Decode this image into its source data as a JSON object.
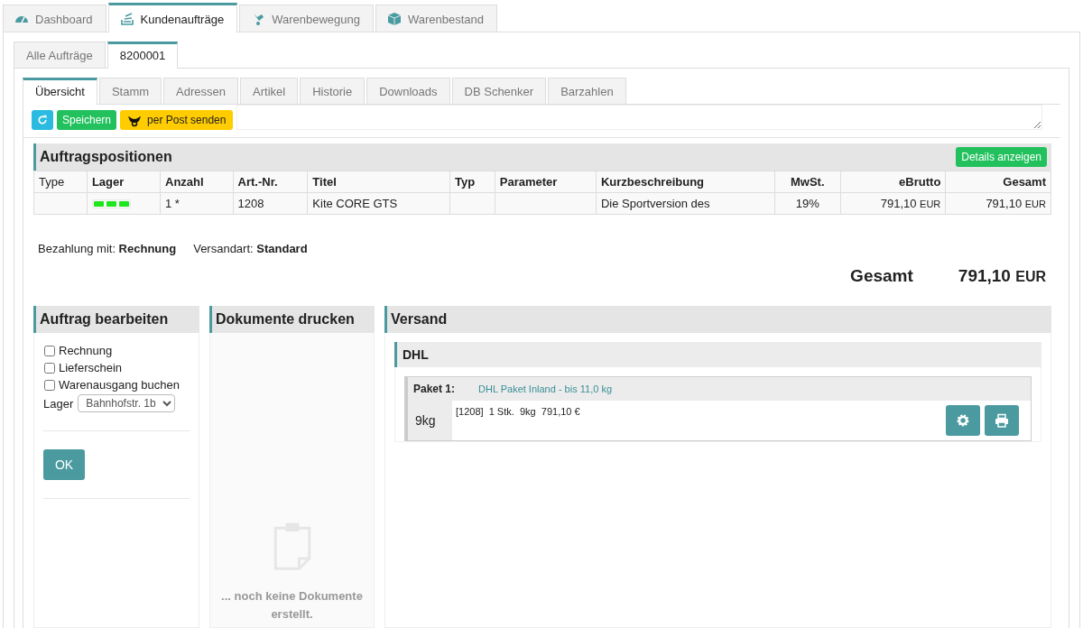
{
  "main_tabs": [
    {
      "label": "Dashboard",
      "selected": false
    },
    {
      "label": "Kundenaufträge",
      "selected": true
    },
    {
      "label": "Warenbewegung",
      "selected": false
    },
    {
      "label": "Warenbestand",
      "selected": false
    }
  ],
  "order_tabs": [
    {
      "label": "Alle Aufträge",
      "selected": false
    },
    {
      "label": "8200001",
      "selected": true
    }
  ],
  "detail_tabs": [
    {
      "label": "Übersicht",
      "selected": true
    },
    {
      "label": "Stamm",
      "selected": false
    },
    {
      "label": "Adressen",
      "selected": false
    },
    {
      "label": "Artikel",
      "selected": false
    },
    {
      "label": "Historie",
      "selected": false
    },
    {
      "label": "Downloads",
      "selected": false
    },
    {
      "label": "DB Schenker",
      "selected": false
    },
    {
      "label": "Barzahlen",
      "selected": false
    }
  ],
  "toolbar": [
    {
      "kind": "refresh"
    },
    {
      "kind": "save",
      "label": "Speichern"
    },
    {
      "kind": "post",
      "label": "per Post senden"
    }
  ],
  "positions": {
    "title": "Auftragspositionen",
    "details_button": "Details anzeigen",
    "columns": [
      {
        "label": "Type",
        "bold": false
      },
      {
        "label": "Lager",
        "bold": true
      },
      {
        "label": "Anzahl",
        "bold": true
      },
      {
        "label": "Art.-Nr.",
        "bold": true
      },
      {
        "label": "Titel",
        "bold": true
      },
      {
        "label": "Typ",
        "bold": true
      },
      {
        "label": "Parameter",
        "bold": true
      },
      {
        "label": "Kurzbeschreibung",
        "bold": true
      },
      {
        "label": "MwSt.",
        "bold": true
      },
      {
        "label": "eBrutto",
        "bold": true
      },
      {
        "label": "Gesamt",
        "bold": true
      }
    ],
    "rows": [
      {
        "cells": [
          {
            "kind": "text",
            "text": ""
          },
          {
            "kind": "stock"
          },
          {
            "kind": "text",
            "text": "1 *"
          },
          {
            "kind": "text",
            "text": "1208"
          },
          {
            "kind": "text",
            "text": "Kite CORE GTS"
          },
          {
            "kind": "text",
            "text": ""
          },
          {
            "kind": "text",
            "text": ""
          },
          {
            "kind": "text",
            "text": "Die Sportversion des"
          },
          {
            "kind": "text",
            "text": "19%"
          },
          {
            "kind": "money",
            "amount": "791,10",
            "currency": "EUR"
          },
          {
            "kind": "money",
            "amount": "791,10",
            "currency": "EUR"
          }
        ]
      }
    ]
  },
  "summary": {
    "payment_label": "Bezahlung mit:",
    "payment": "Rechnung",
    "shipping_label": "Versandart:",
    "shipping": "Standard",
    "total_label": "Gesamt",
    "total_amount": "791,10",
    "total_currency": "EUR"
  },
  "edit_order": {
    "title": "Auftrag bearbeiten",
    "options": [
      {
        "label": "Rechnung",
        "checked": false
      },
      {
        "label": "Lieferschein",
        "checked": false
      },
      {
        "label": "Warenausgang buchen",
        "checked": false
      }
    ],
    "warehouse_label": "Lager",
    "warehouse": "Bahnhofstr. 1b",
    "ok": "OK"
  },
  "documents": {
    "title": "Dokumente drucken",
    "empty": "... noch keine Dokumente erstellt."
  },
  "shipping": {
    "title": "Versand",
    "carrier": "DHL",
    "packages": [
      {
        "label": "Paket 1:",
        "product": "DHL Paket Inland - bis 11,0 kg",
        "weight": "9kg",
        "contents": "[1208]  1 Stk.  9kg  791,10 €"
      }
    ]
  }
}
